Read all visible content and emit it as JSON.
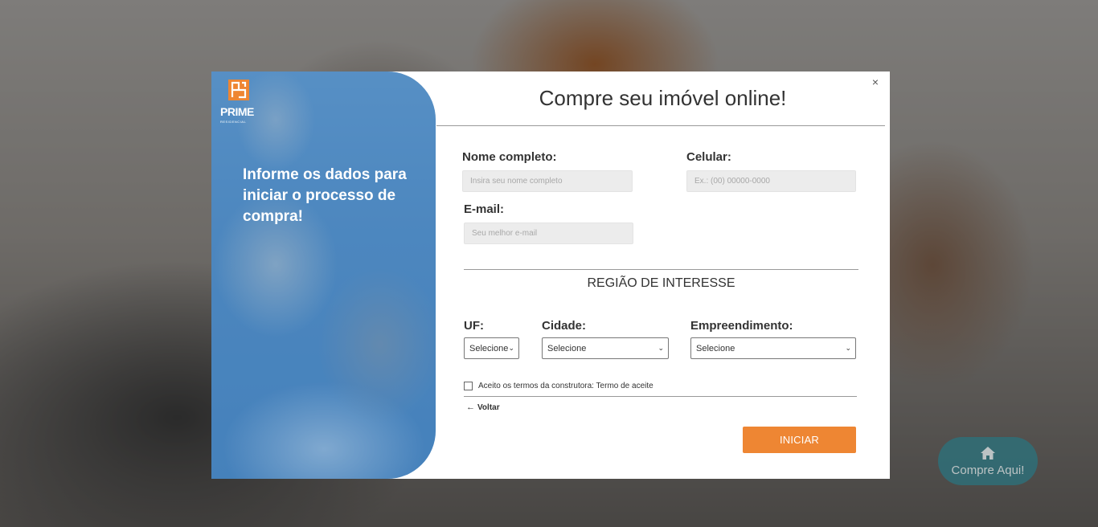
{
  "modal": {
    "title": "Compre seu imóvel online!",
    "close": "×",
    "headline": "Informe os dados para iniciar o processo de compra!",
    "logo": {
      "brand": "PRIME",
      "sub": "RESIDENCIAL"
    },
    "form": {
      "name_label": "Nome completo:",
      "name_placeholder": "Insira seu nome completo",
      "phone_label": "Celular:",
      "phone_placeholder": "Ex.: (00) 00000-0000",
      "email_label": "E-mail:",
      "email_placeholder": "Seu melhor e-mail",
      "region_title": "REGIÃO DE INTERESSE",
      "uf_label": "UF:",
      "uf_value": "Selecione",
      "city_label": "Cidade:",
      "city_value": "Selecione",
      "project_label": "Empreendimento:",
      "project_value": "Selecione",
      "terms_text": "Aceito os termos da construtora: Termo de aceite",
      "back_label": "Voltar",
      "start_label": "INICIAR"
    }
  },
  "fab": {
    "label": "Compre Aqui!",
    "icon": "home-icon"
  },
  "colors": {
    "accent": "#ee8633",
    "fab": "#2f6f78",
    "panel": "#5a8fc0"
  }
}
